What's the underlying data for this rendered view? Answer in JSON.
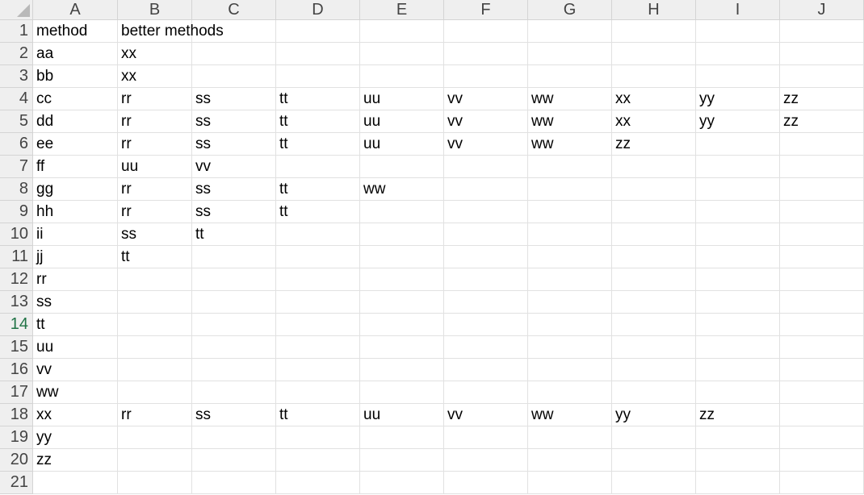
{
  "columns": [
    "A",
    "B",
    "C",
    "D",
    "E",
    "F",
    "G",
    "H",
    "I",
    "J"
  ],
  "row_numbers": [
    "1",
    "2",
    "3",
    "4",
    "5",
    "6",
    "7",
    "8",
    "9",
    "10",
    "11",
    "12",
    "13",
    "14",
    "15",
    "16",
    "17",
    "18",
    "19",
    "20",
    "21"
  ],
  "active_row": "14",
  "rows": [
    [
      "method",
      "better methods",
      "",
      "",
      "",
      "",
      "",
      "",
      "",
      ""
    ],
    [
      "aa",
      "xx",
      "",
      "",
      "",
      "",
      "",
      "",
      "",
      ""
    ],
    [
      "bb",
      "xx",
      "",
      "",
      "",
      "",
      "",
      "",
      "",
      ""
    ],
    [
      "cc",
      "rr",
      "ss",
      "tt",
      "uu",
      "vv",
      "ww",
      "xx",
      "yy",
      "zz"
    ],
    [
      "dd",
      "rr",
      "ss",
      "tt",
      "uu",
      "vv",
      "ww",
      "xx",
      "yy",
      "zz"
    ],
    [
      "ee",
      "rr",
      "ss",
      "tt",
      "uu",
      "vv",
      "ww",
      "zz",
      "",
      ""
    ],
    [
      "ff",
      "uu",
      "vv",
      "",
      "",
      "",
      "",
      "",
      "",
      ""
    ],
    [
      "gg",
      "rr",
      "ss",
      "tt",
      "ww",
      "",
      "",
      "",
      "",
      ""
    ],
    [
      "hh",
      "rr",
      "ss",
      "tt",
      "",
      "",
      "",
      "",
      "",
      ""
    ],
    [
      "ii",
      "ss",
      "tt",
      "",
      "",
      "",
      "",
      "",
      "",
      ""
    ],
    [
      "jj",
      "tt",
      "",
      "",
      "",
      "",
      "",
      "",
      "",
      ""
    ],
    [
      "rr",
      "",
      "",
      "",
      "",
      "",
      "",
      "",
      "",
      ""
    ],
    [
      "ss",
      "",
      "",
      "",
      "",
      "",
      "",
      "",
      "",
      ""
    ],
    [
      "tt",
      "",
      "",
      "",
      "",
      "",
      "",
      "",
      "",
      ""
    ],
    [
      "uu",
      "",
      "",
      "",
      "",
      "",
      "",
      "",
      "",
      ""
    ],
    [
      "vv",
      "",
      "",
      "",
      "",
      "",
      "",
      "",
      "",
      ""
    ],
    [
      "ww",
      "",
      "",
      "",
      "",
      "",
      "",
      "",
      "",
      ""
    ],
    [
      "xx",
      "rr",
      "ss",
      "tt",
      "uu",
      "vv",
      "ww",
      "yy",
      "zz",
      ""
    ],
    [
      "yy",
      "",
      "",
      "",
      "",
      "",
      "",
      "",
      "",
      ""
    ],
    [
      "zz",
      "",
      "",
      "",
      "",
      "",
      "",
      "",
      "",
      ""
    ],
    [
      "",
      "",
      "",
      "",
      "",
      "",
      "",
      "",
      "",
      ""
    ]
  ],
  "colors": {
    "header_bg": "#efefef",
    "header_text": "#444444",
    "active_header_text": "#217346",
    "gridline": "#e1e1e1"
  }
}
